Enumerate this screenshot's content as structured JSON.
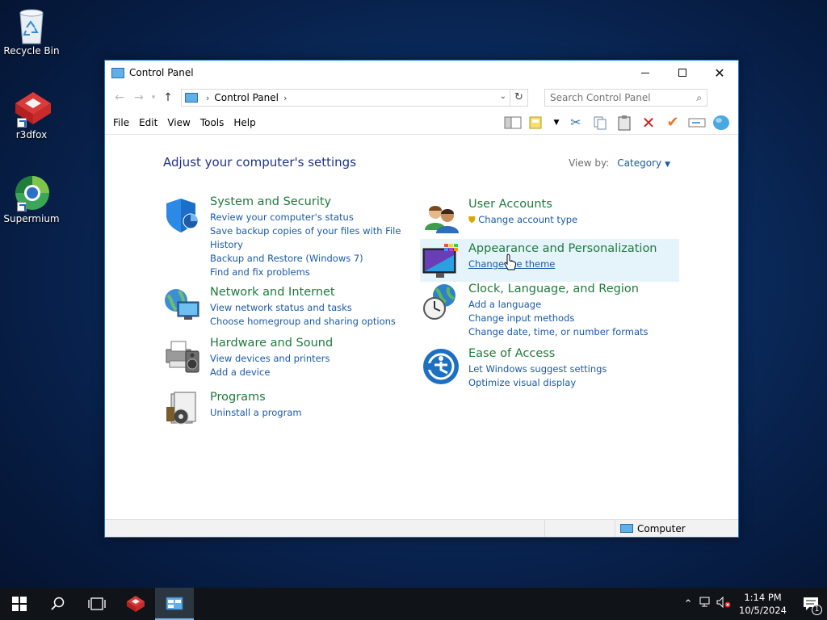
{
  "desktop": {
    "icons": [
      {
        "label": "Recycle Bin"
      },
      {
        "label": "r3dfox"
      },
      {
        "label": "Supermium"
      }
    ]
  },
  "window": {
    "title": "Control Panel",
    "address": {
      "crumb": "Control Panel"
    },
    "search": {
      "placeholder": "Search Control Panel"
    },
    "menu": [
      "File",
      "Edit",
      "View",
      "Tools",
      "Help"
    ],
    "heading": "Adjust your computer's settings",
    "view_by": {
      "label": "View by:",
      "value": "Category"
    },
    "categories": [
      {
        "title": "System and Security",
        "links": [
          "Review your computer's status",
          "Save backup copies of your files with File",
          "History",
          "Backup and Restore (Windows 7)",
          "Find and fix problems"
        ]
      },
      {
        "title": "Network and Internet",
        "links": [
          "View network status and tasks",
          "Choose homegroup and sharing options"
        ]
      },
      {
        "title": "Hardware and Sound",
        "links": [
          "View devices and printers",
          "Add a device"
        ]
      },
      {
        "title": "Programs",
        "links": [
          "Uninstall a program"
        ]
      },
      {
        "title": "User Accounts",
        "links": [
          "Change account type"
        ]
      },
      {
        "title": "Appearance and Personalization",
        "links": [
          "Change the theme"
        ]
      },
      {
        "title": "Clock, Language, and Region",
        "links": [
          "Add a language",
          "Change input methods",
          "Change date, time, or number formats"
        ]
      },
      {
        "title": "Ease of Access",
        "links": [
          "Let Windows suggest settings",
          "Optimize visual display"
        ]
      }
    ],
    "status": {
      "computer": "Computer"
    }
  },
  "taskbar": {
    "time": "1:14 PM",
    "date": "10/5/2024",
    "notification_count": "1"
  }
}
